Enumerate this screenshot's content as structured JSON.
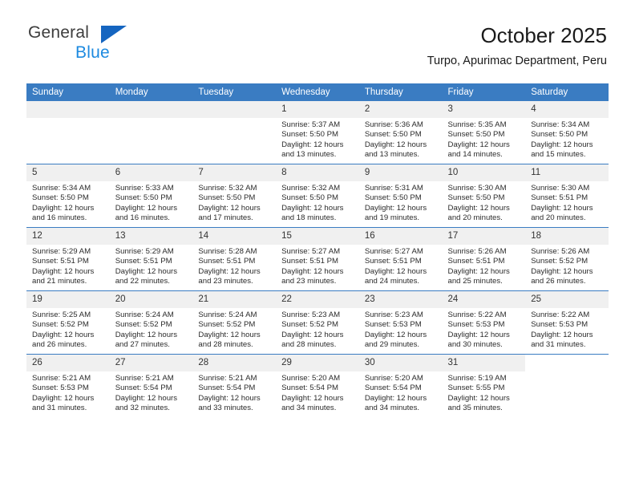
{
  "brand": {
    "name_part1": "General",
    "name_part2": "Blue",
    "accent_color": "#1d8ae0",
    "triangle_color": "#1565c0"
  },
  "header": {
    "title": "October 2025",
    "subtitle": "Turpo, Apurimac Department, Peru"
  },
  "calendar": {
    "header_bg": "#3a7cc2",
    "daynum_bg": "#f0f0f0",
    "weekdays": [
      "Sunday",
      "Monday",
      "Tuesday",
      "Wednesday",
      "Thursday",
      "Friday",
      "Saturday"
    ],
    "labels": {
      "sunrise": "Sunrise:",
      "sunset": "Sunset:",
      "daylight": "Daylight:"
    },
    "weeks": [
      [
        {
          "day": "",
          "empty": true
        },
        {
          "day": "",
          "empty": true
        },
        {
          "day": "",
          "empty": true
        },
        {
          "day": "1",
          "sunrise": "Sunrise: 5:37 AM",
          "sunset": "Sunset: 5:50 PM",
          "daylight_line1": "Daylight: 12 hours",
          "daylight_line2": "and 13 minutes."
        },
        {
          "day": "2",
          "sunrise": "Sunrise: 5:36 AM",
          "sunset": "Sunset: 5:50 PM",
          "daylight_line1": "Daylight: 12 hours",
          "daylight_line2": "and 13 minutes."
        },
        {
          "day": "3",
          "sunrise": "Sunrise: 5:35 AM",
          "sunset": "Sunset: 5:50 PM",
          "daylight_line1": "Daylight: 12 hours",
          "daylight_line2": "and 14 minutes."
        },
        {
          "day": "4",
          "sunrise": "Sunrise: 5:34 AM",
          "sunset": "Sunset: 5:50 PM",
          "daylight_line1": "Daylight: 12 hours",
          "daylight_line2": "and 15 minutes."
        }
      ],
      [
        {
          "day": "5",
          "sunrise": "Sunrise: 5:34 AM",
          "sunset": "Sunset: 5:50 PM",
          "daylight_line1": "Daylight: 12 hours",
          "daylight_line2": "and 16 minutes."
        },
        {
          "day": "6",
          "sunrise": "Sunrise: 5:33 AM",
          "sunset": "Sunset: 5:50 PM",
          "daylight_line1": "Daylight: 12 hours",
          "daylight_line2": "and 16 minutes."
        },
        {
          "day": "7",
          "sunrise": "Sunrise: 5:32 AM",
          "sunset": "Sunset: 5:50 PM",
          "daylight_line1": "Daylight: 12 hours",
          "daylight_line2": "and 17 minutes."
        },
        {
          "day": "8",
          "sunrise": "Sunrise: 5:32 AM",
          "sunset": "Sunset: 5:50 PM",
          "daylight_line1": "Daylight: 12 hours",
          "daylight_line2": "and 18 minutes."
        },
        {
          "day": "9",
          "sunrise": "Sunrise: 5:31 AM",
          "sunset": "Sunset: 5:50 PM",
          "daylight_line1": "Daylight: 12 hours",
          "daylight_line2": "and 19 minutes."
        },
        {
          "day": "10",
          "sunrise": "Sunrise: 5:30 AM",
          "sunset": "Sunset: 5:50 PM",
          "daylight_line1": "Daylight: 12 hours",
          "daylight_line2": "and 20 minutes."
        },
        {
          "day": "11",
          "sunrise": "Sunrise: 5:30 AM",
          "sunset": "Sunset: 5:51 PM",
          "daylight_line1": "Daylight: 12 hours",
          "daylight_line2": "and 20 minutes."
        }
      ],
      [
        {
          "day": "12",
          "sunrise": "Sunrise: 5:29 AM",
          "sunset": "Sunset: 5:51 PM",
          "daylight_line1": "Daylight: 12 hours",
          "daylight_line2": "and 21 minutes."
        },
        {
          "day": "13",
          "sunrise": "Sunrise: 5:29 AM",
          "sunset": "Sunset: 5:51 PM",
          "daylight_line1": "Daylight: 12 hours",
          "daylight_line2": "and 22 minutes."
        },
        {
          "day": "14",
          "sunrise": "Sunrise: 5:28 AM",
          "sunset": "Sunset: 5:51 PM",
          "daylight_line1": "Daylight: 12 hours",
          "daylight_line2": "and 23 minutes."
        },
        {
          "day": "15",
          "sunrise": "Sunrise: 5:27 AM",
          "sunset": "Sunset: 5:51 PM",
          "daylight_line1": "Daylight: 12 hours",
          "daylight_line2": "and 23 minutes."
        },
        {
          "day": "16",
          "sunrise": "Sunrise: 5:27 AM",
          "sunset": "Sunset: 5:51 PM",
          "daylight_line1": "Daylight: 12 hours",
          "daylight_line2": "and 24 minutes."
        },
        {
          "day": "17",
          "sunrise": "Sunrise: 5:26 AM",
          "sunset": "Sunset: 5:51 PM",
          "daylight_line1": "Daylight: 12 hours",
          "daylight_line2": "and 25 minutes."
        },
        {
          "day": "18",
          "sunrise": "Sunrise: 5:26 AM",
          "sunset": "Sunset: 5:52 PM",
          "daylight_line1": "Daylight: 12 hours",
          "daylight_line2": "and 26 minutes."
        }
      ],
      [
        {
          "day": "19",
          "sunrise": "Sunrise: 5:25 AM",
          "sunset": "Sunset: 5:52 PM",
          "daylight_line1": "Daylight: 12 hours",
          "daylight_line2": "and 26 minutes."
        },
        {
          "day": "20",
          "sunrise": "Sunrise: 5:24 AM",
          "sunset": "Sunset: 5:52 PM",
          "daylight_line1": "Daylight: 12 hours",
          "daylight_line2": "and 27 minutes."
        },
        {
          "day": "21",
          "sunrise": "Sunrise: 5:24 AM",
          "sunset": "Sunset: 5:52 PM",
          "daylight_line1": "Daylight: 12 hours",
          "daylight_line2": "and 28 minutes."
        },
        {
          "day": "22",
          "sunrise": "Sunrise: 5:23 AM",
          "sunset": "Sunset: 5:52 PM",
          "daylight_line1": "Daylight: 12 hours",
          "daylight_line2": "and 28 minutes."
        },
        {
          "day": "23",
          "sunrise": "Sunrise: 5:23 AM",
          "sunset": "Sunset: 5:53 PM",
          "daylight_line1": "Daylight: 12 hours",
          "daylight_line2": "and 29 minutes."
        },
        {
          "day": "24",
          "sunrise": "Sunrise: 5:22 AM",
          "sunset": "Sunset: 5:53 PM",
          "daylight_line1": "Daylight: 12 hours",
          "daylight_line2": "and 30 minutes."
        },
        {
          "day": "25",
          "sunrise": "Sunrise: 5:22 AM",
          "sunset": "Sunset: 5:53 PM",
          "daylight_line1": "Daylight: 12 hours",
          "daylight_line2": "and 31 minutes."
        }
      ],
      [
        {
          "day": "26",
          "sunrise": "Sunrise: 5:21 AM",
          "sunset": "Sunset: 5:53 PM",
          "daylight_line1": "Daylight: 12 hours",
          "daylight_line2": "and 31 minutes."
        },
        {
          "day": "27",
          "sunrise": "Sunrise: 5:21 AM",
          "sunset": "Sunset: 5:54 PM",
          "daylight_line1": "Daylight: 12 hours",
          "daylight_line2": "and 32 minutes."
        },
        {
          "day": "28",
          "sunrise": "Sunrise: 5:21 AM",
          "sunset": "Sunset: 5:54 PM",
          "daylight_line1": "Daylight: 12 hours",
          "daylight_line2": "and 33 minutes."
        },
        {
          "day": "29",
          "sunrise": "Sunrise: 5:20 AM",
          "sunset": "Sunset: 5:54 PM",
          "daylight_line1": "Daylight: 12 hours",
          "daylight_line2": "and 34 minutes."
        },
        {
          "day": "30",
          "sunrise": "Sunrise: 5:20 AM",
          "sunset": "Sunset: 5:54 PM",
          "daylight_line1": "Daylight: 12 hours",
          "daylight_line2": "and 34 minutes."
        },
        {
          "day": "31",
          "sunrise": "Sunrise: 5:19 AM",
          "sunset": "Sunset: 5:55 PM",
          "daylight_line1": "Daylight: 12 hours",
          "daylight_line2": "and 35 minutes."
        },
        {
          "day": "",
          "blank": true
        }
      ]
    ]
  }
}
